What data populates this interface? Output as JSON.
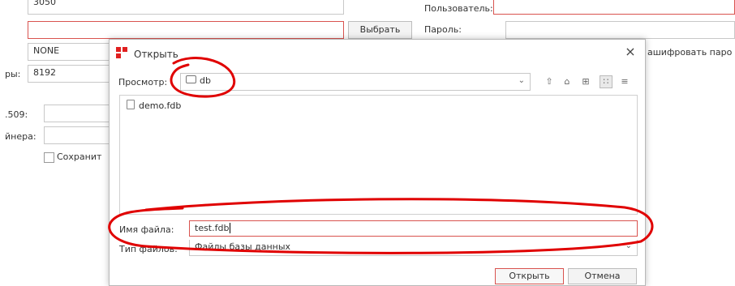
{
  "background_form": {
    "port_value": "3050",
    "user_label": "Пользователь:",
    "choose_button": "Выбрать",
    "password_label": "Пароль:",
    "charset_value": "NONE",
    "encrypt_label": "ашифровать паро",
    "page_size_label": "ры:",
    "page_size_value": "8192",
    "x509_label": ".509:",
    "container_label": "йнера:",
    "save_checkbox_label": "Сохранит"
  },
  "dialog": {
    "title": "Открыть",
    "close": "×",
    "look_in_label": "Просмотр:",
    "look_in_value": "db",
    "files": [
      {
        "name": "demo.fdb"
      }
    ],
    "file_name_label": "Имя файла:",
    "file_name_value": "test.fdb",
    "file_type_label": "Тип файлов:",
    "file_type_value": "Файлы базы данных",
    "open_button": "Открыть",
    "cancel_button": "Отмена"
  },
  "colors": {
    "annotation": "#e00000",
    "brand": "#e02020",
    "field_error_border": "#d9534f"
  }
}
